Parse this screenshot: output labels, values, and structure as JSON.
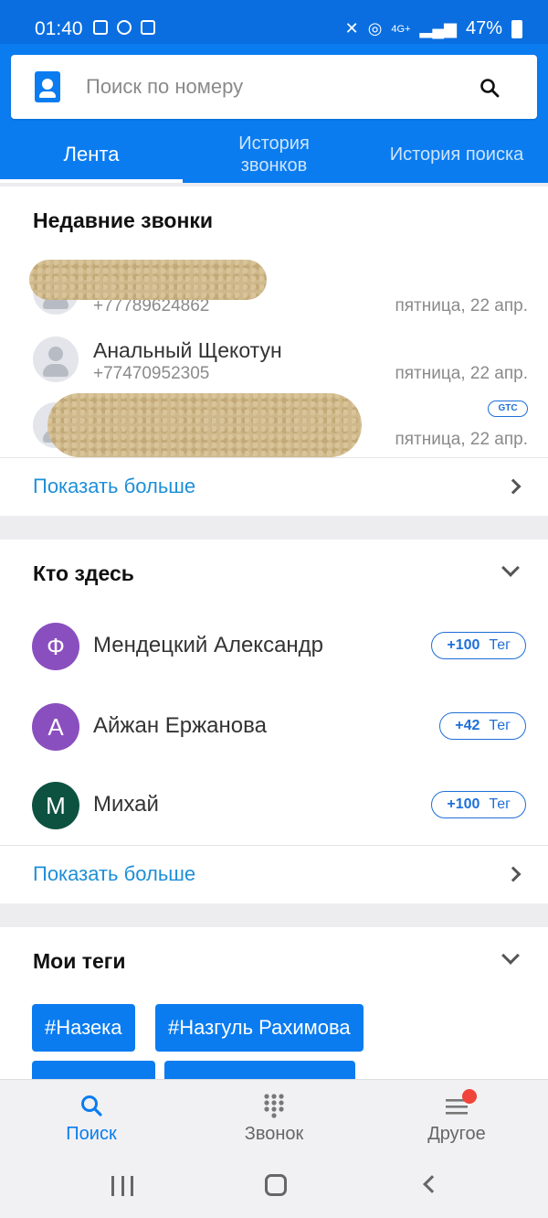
{
  "status_bar": {
    "time": "01:40",
    "network": "4G+",
    "battery": "47%"
  },
  "search": {
    "placeholder": "Поиск по номеру"
  },
  "tabs": [
    {
      "label": "Лента",
      "active": true
    },
    {
      "label": "История\nзвонков",
      "active": false
    },
    {
      "label": "История поиска",
      "active": false
    }
  ],
  "recent_calls": {
    "title": "Недавние звонки",
    "items": [
      {
        "name": "",
        "phone": "+77789624862",
        "date": "пятница, 22 апр.",
        "redacted": true
      },
      {
        "name": "Анальный Щекотун",
        "phone": "+77470952305",
        "date": "пятница, 22 апр."
      },
      {
        "name": "",
        "phone": "",
        "date": "пятница, 22 апр.",
        "badge": "GTC",
        "redacted": true
      }
    ],
    "show_more": "Показать больше"
  },
  "who_here": {
    "title": "Кто здесь",
    "items": [
      {
        "initial": "Ф",
        "name": "Мендецкий Александр",
        "count": "+100",
        "tag_label": "Тег",
        "color": "#8a4fbf"
      },
      {
        "initial": "А",
        "name": "Айжан Ержанова",
        "count": "+42",
        "tag_label": "Тег",
        "color": "#8a4fbf"
      },
      {
        "initial": "М",
        "name": "Михай",
        "count": "+100",
        "tag_label": "Тег",
        "color": "#0d5240"
      }
    ],
    "show_more": "Показать больше"
  },
  "my_tags": {
    "title": "Мои теги",
    "items": [
      "#Назека",
      "#Назгуль Рахимова"
    ]
  },
  "bottom_nav": [
    {
      "label": "Поиск",
      "icon": "search-icon",
      "active": true
    },
    {
      "label": "Звонок",
      "icon": "dialpad-icon",
      "active": false
    },
    {
      "label": "Другое",
      "icon": "menu-icon",
      "active": false,
      "notification_dot": true
    }
  ],
  "colors": {
    "accent": "#0a7cf0",
    "link": "#1e8fd8",
    "notification": "#f0443a"
  }
}
